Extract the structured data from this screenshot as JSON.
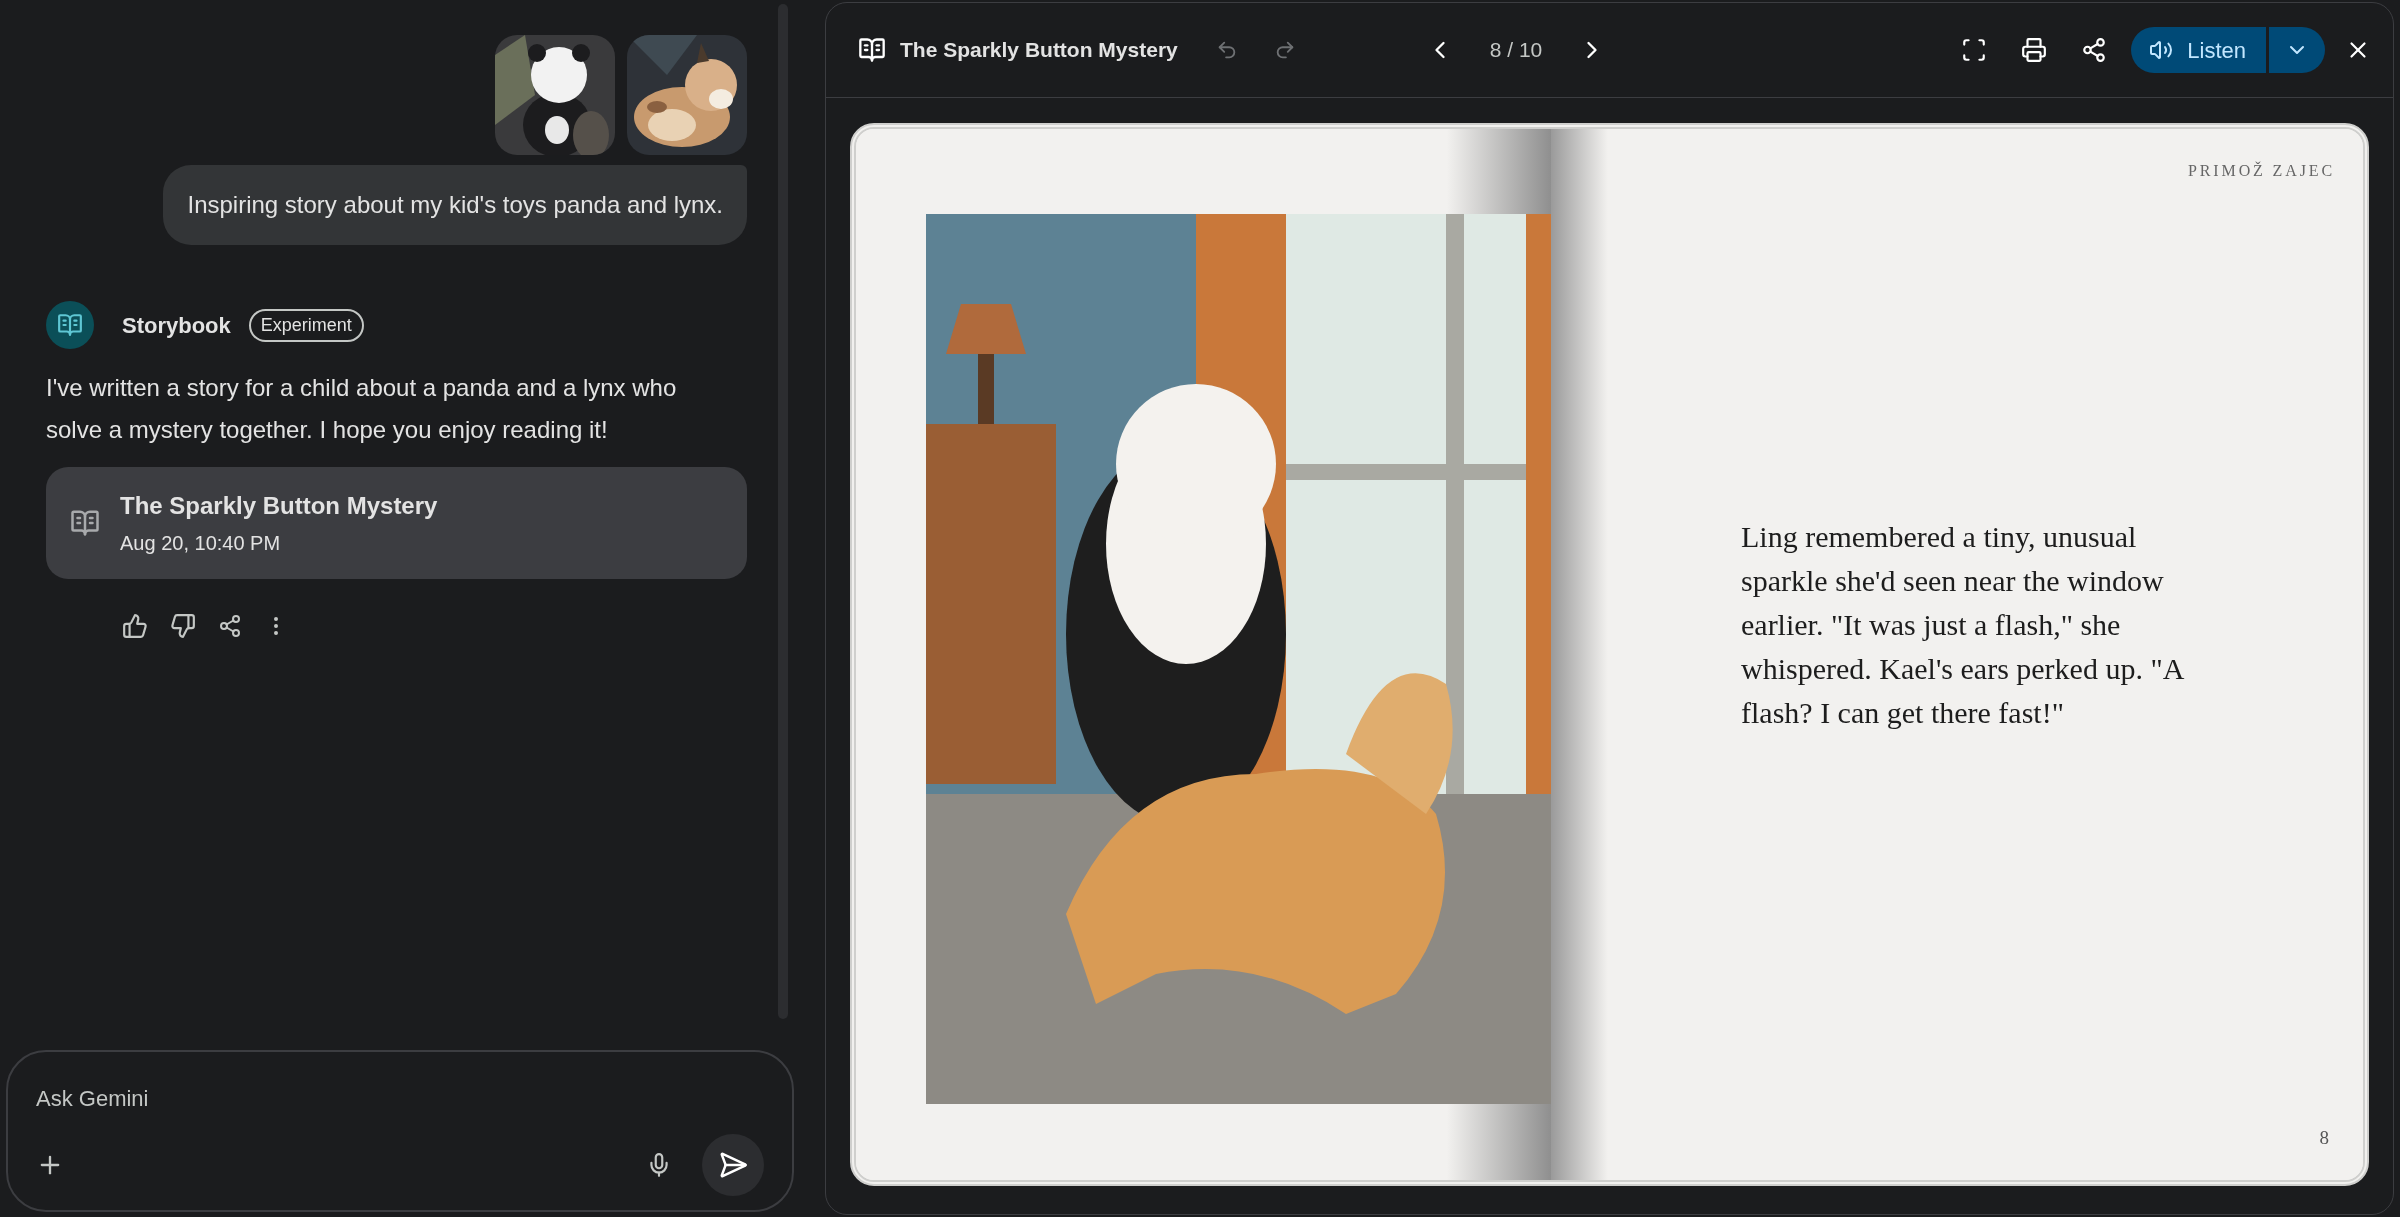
{
  "chat": {
    "user_message": "Inspiring story about my kid's toys panda and lynx.",
    "response": {
      "agent": "Storybook",
      "badge": "Experiment",
      "text": "I've written a story for a child about a panda and a lynx who solve a mystery together. I hope you enjoy reading it!",
      "story_card": {
        "title": "The Sparkly Button Mystery",
        "date": "Aug 20, 10:40 PM"
      }
    }
  },
  "input": {
    "placeholder": "Ask Gemini"
  },
  "viewer": {
    "title": "The Sparkly Button Mystery",
    "undo": {
      "disabled": true
    },
    "redo": {
      "disabled": true
    },
    "page_indicator": "8 / 10",
    "listen_button": "Listen",
    "book": {
      "author": "PRIMOŽ ZAJEC",
      "text": "Ling remembered a tiny, unusual sparkle she'd seen near the window earlier. \"It was just a flash,\" she whispered. Kael's ears perked up. \"A flash? I can get there fast!\"",
      "page_number": "8"
    }
  }
}
